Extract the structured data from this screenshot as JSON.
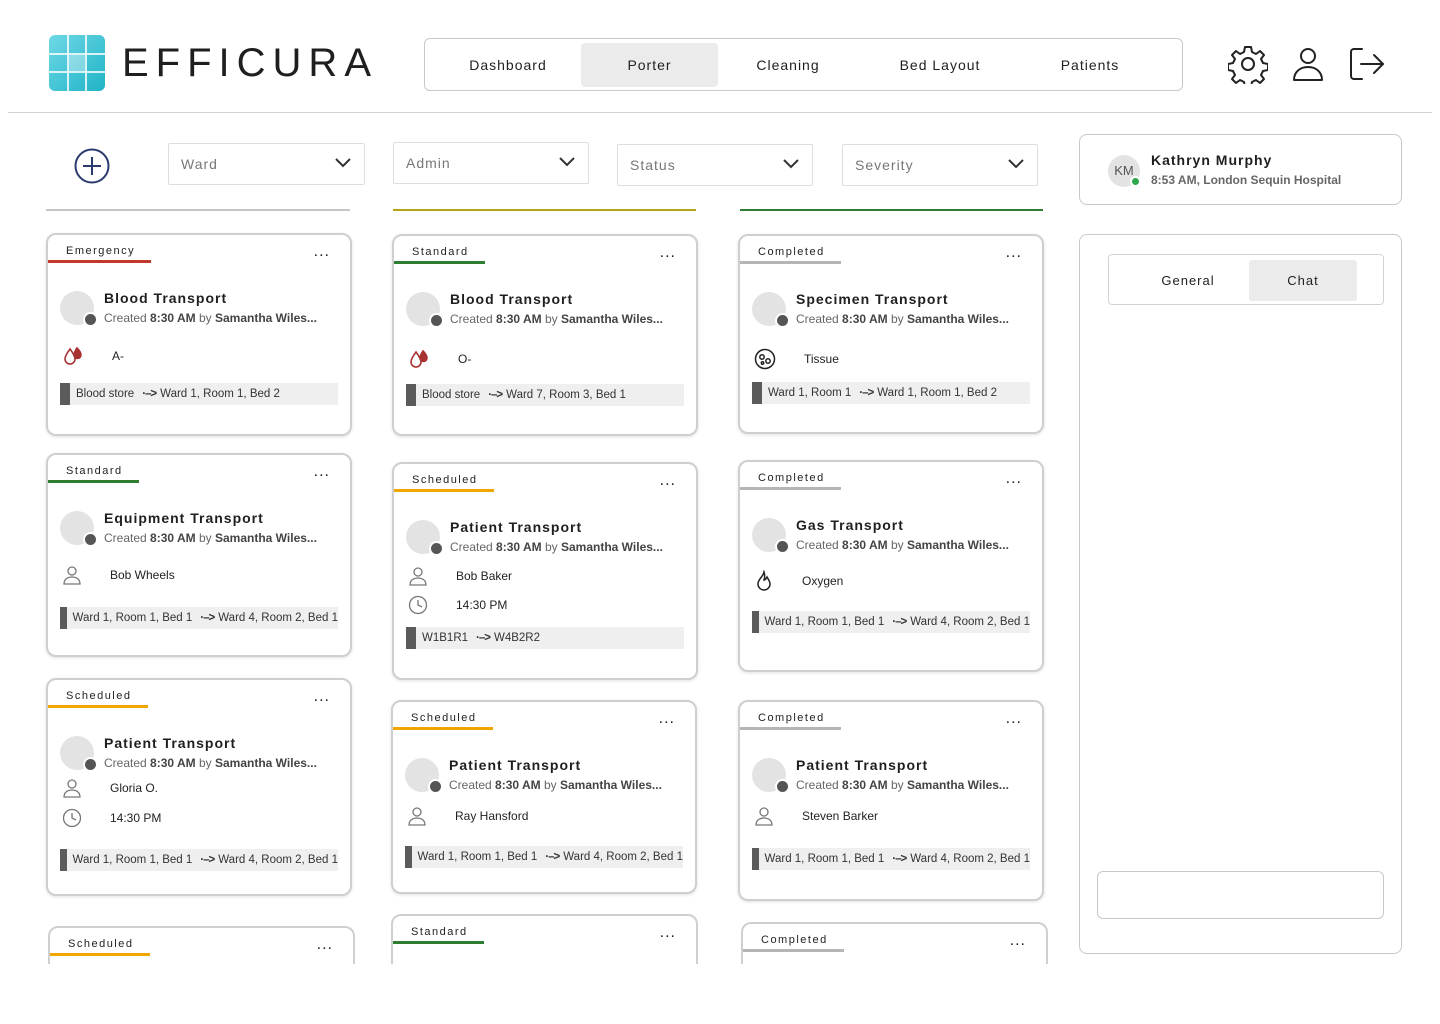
{
  "app": {
    "name": "EFFICURA"
  },
  "nav": {
    "tabs": [
      {
        "label": "Dashboard",
        "active": false
      },
      {
        "label": "Porter",
        "active": true
      },
      {
        "label": "Cleaning",
        "active": false
      },
      {
        "label": "Bed Layout",
        "active": false
      },
      {
        "label": "Patients",
        "active": false
      }
    ]
  },
  "header_icons": [
    "gear-icon",
    "user-icon",
    "logout-icon"
  ],
  "filters": {
    "add_icon": "plus-circle-icon",
    "ward": "Ward",
    "admin": "Admin",
    "status": "Status",
    "severity": "Severity"
  },
  "status_colors": {
    "Emergency": "#c0392b",
    "Standard": "#2e7d32",
    "Scheduled": "#f0a500",
    "Completed": "#b5b5b5"
  },
  "column_line_colors": [
    "#c6c6c6",
    "#b5a619",
    "#2e7d32"
  ],
  "columns": [
    {
      "cards": [
        {
          "status": "Emergency",
          "title": "Blood Transport",
          "created_prefix": "Created",
          "time": "8:30 AM",
          "by": "by",
          "author": "Samantha Wiles...",
          "detail_icon": "blood-drop-icon",
          "detail": "A-",
          "route_from": "Blood store",
          "arrow": "·–>",
          "route_to": "Ward 1, Room 1, Bed 2"
        },
        {
          "status": "Standard",
          "title": "Equipment Transport",
          "created_prefix": "Created",
          "time": "8:30 AM",
          "by": "by",
          "author": "Samantha Wiles...",
          "detail_icon": "person-icon",
          "detail": "Bob Wheels",
          "route_from": "Ward 1, Room 1, Bed 1",
          "arrow": "·–>",
          "route_to": "Ward 4, Room 2, Bed 1"
        },
        {
          "status": "Scheduled",
          "title": "Patient Transport",
          "created_prefix": "Created",
          "time": "8:30 AM",
          "by": "by",
          "author": "Samantha Wiles...",
          "detail_icon": "person-icon",
          "detail": "Gloria O.",
          "time_icon": "clock-icon",
          "sched_time": "14:30 PM",
          "route_from": "Ward 1, Room 1, Bed 1",
          "arrow": "·–>",
          "route_to": "Ward 4, Room 2, Bed 1"
        },
        {
          "status": "Scheduled"
        }
      ]
    },
    {
      "cards": [
        {
          "status": "Standard",
          "title": "Blood Transport",
          "created_prefix": "Created",
          "time": "8:30 AM",
          "by": "by",
          "author": "Samantha Wiles...",
          "detail_icon": "blood-drop-icon",
          "detail": "O-",
          "route_from": "Blood store",
          "arrow": "·–>",
          "route_to": "Ward 7, Room 3, Bed 1"
        },
        {
          "status": "Scheduled",
          "title": "Patient Transport",
          "created_prefix": "Created",
          "time": "8:30 AM",
          "by": "by",
          "author": "Samantha Wiles...",
          "detail_icon": "person-icon",
          "detail": "Bob Baker",
          "time_icon": "clock-icon",
          "sched_time": "14:30 PM",
          "route_from": "W1B1R1",
          "arrow": "·–>",
          "route_to": "W4B2R2"
        },
        {
          "status": "Scheduled",
          "title": "Patient Transport",
          "created_prefix": "Created",
          "time": "8:30 AM",
          "by": "by",
          "author": "Samantha Wiles...",
          "detail_icon": "person-icon",
          "detail": "Ray Hansford",
          "route_from": "Ward 1, Room 1, Bed 1",
          "arrow": "·–>",
          "route_to": "Ward 4, Room 2, Bed 1"
        },
        {
          "status": "Standard"
        }
      ]
    },
    {
      "cards": [
        {
          "status": "Completed",
          "title": "Specimen Transport",
          "created_prefix": "Created",
          "time": "8:30 AM",
          "by": "by",
          "author": "Samantha Wiles...",
          "detail_icon": "specimen-icon",
          "detail": "Tissue",
          "route_from": "Ward 1, Room 1",
          "arrow": "·–>",
          "route_to": "Ward 1, Room 1, Bed 2"
        },
        {
          "status": "Completed",
          "title": "Gas Transport",
          "created_prefix": "Created",
          "time": "8:30 AM",
          "by": "by",
          "author": "Samantha Wiles...",
          "detail_icon": "flame-icon",
          "detail": "Oxygen",
          "route_from": "Ward 1, Room 1, Bed 1",
          "arrow": "·–>",
          "route_to": "Ward 4, Room 2, Bed 1"
        },
        {
          "status": "Completed",
          "title": "Patient Transport",
          "created_prefix": "Created",
          "time": "8:30 AM",
          "by": "by",
          "author": "Samantha Wiles...",
          "detail_icon": "person-icon",
          "detail": "Steven Barker",
          "route_from": "Ward 1, Room 1, Bed 1",
          "arrow": "·–>",
          "route_to": "Ward 4, Room 2, Bed 1"
        },
        {
          "status": "Completed"
        }
      ]
    }
  ],
  "card_menu": "...",
  "user": {
    "initials": "KM",
    "name": "Kathryn Murphy",
    "subtitle": "8:53 AM, London Sequin Hospital",
    "online": true
  },
  "panel": {
    "tabs": [
      {
        "label": "General",
        "active": false
      },
      {
        "label": "Chat",
        "active": true
      }
    ],
    "input_value": ""
  }
}
